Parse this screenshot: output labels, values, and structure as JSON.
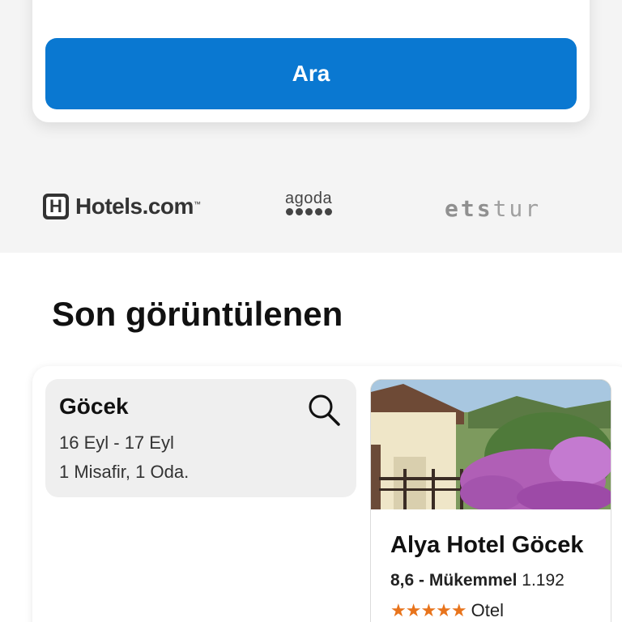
{
  "search": {
    "button_label": "Ara"
  },
  "partners": {
    "hotelscom": "Hotels.com",
    "hotelscom_tm": "™",
    "agoda": "agoda",
    "etstur_bold": "ets",
    "etstur_light": "tur"
  },
  "recent": {
    "title": "Son görüntülenen",
    "search_item": {
      "destination": "Göcek",
      "dates": "16 Eyl - 17 Eyl",
      "guests": "1 Misafir, 1 Oda."
    },
    "hotel": {
      "name": "Alya Hotel Göcek",
      "score": "8,6",
      "separator": " - ",
      "rating_text": "Mükemmel",
      "review_count": "1.192",
      "stars": "★★★★★",
      "star_count": 5,
      "type": "Otel"
    }
  },
  "colors": {
    "accent": "#0a78d1",
    "stars": "#e8741c"
  }
}
